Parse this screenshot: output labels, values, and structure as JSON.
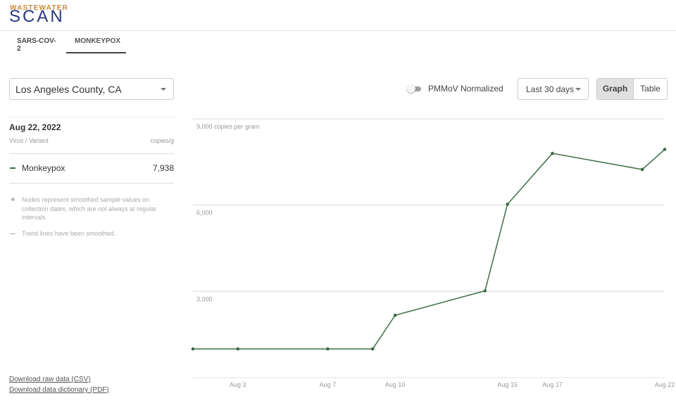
{
  "header": {
    "logo_top": "WASTEWATER",
    "logo_main": "SCAN"
  },
  "tabs": [
    {
      "label": "SARS-COV-2",
      "active": false
    },
    {
      "label": "MONKEYPOX",
      "active": true
    }
  ],
  "location": {
    "selected": "Los Angeles County, CA"
  },
  "controls": {
    "toggle_label": "PMMoV Normalized",
    "toggle_on": false,
    "range_selected": "Last 30 days",
    "view_graph": "Graph",
    "view_table": "Table",
    "active_view": "Graph"
  },
  "panel": {
    "date": "Aug 22, 2022",
    "col_left": "Virus / Variant",
    "col_right": "copies/g",
    "rows": [
      {
        "label": "Monkeypox",
        "value": "7,938",
        "color": "#3e6b45"
      }
    ],
    "note_nodes": "Nodes represent smoothed sample values on collection dates, which are not always at regular intervals.",
    "note_trend": "Trend lines have been smoothed."
  },
  "links": {
    "csv": "Download raw data (CSV)",
    "pdf": "Download data dictionary (PDF)"
  },
  "chart_data": {
    "type": "line",
    "title": "",
    "ylabel": "copies per gram",
    "xlabel": "",
    "ylim": [
      0,
      9000
    ],
    "y_ticks": [
      {
        "value": 0,
        "label": ""
      },
      {
        "value": 3000,
        "label": "3,000"
      },
      {
        "value": 6000,
        "label": "6,000"
      },
      {
        "value": 9000,
        "label": "9,000 copies per gram"
      }
    ],
    "x_range_days": [
      1,
      22
    ],
    "x_ticks": [
      {
        "day": 3,
        "label": "Aug 3"
      },
      {
        "day": 7,
        "label": "Aug 7"
      },
      {
        "day": 10,
        "label": "Aug 10"
      },
      {
        "day": 15,
        "label": "Aug 15"
      },
      {
        "day": 17,
        "label": "Aug 17"
      },
      {
        "day": 22,
        "label": "Aug 22"
      }
    ],
    "grid": true,
    "series": [
      {
        "name": "Monkeypox",
        "color": "#3e6b45",
        "points": [
          {
            "date": "Aug 1",
            "day": 1,
            "value": 1000
          },
          {
            "date": "Aug 3",
            "day": 3,
            "value": 1000
          },
          {
            "date": "Aug 7",
            "day": 7,
            "value": 1000
          },
          {
            "date": "Aug 9",
            "day": 9,
            "value": 1000
          },
          {
            "date": "Aug 10",
            "day": 10,
            "value": 2170
          },
          {
            "date": "Aug 14",
            "day": 14,
            "value": 3020
          },
          {
            "date": "Aug 15",
            "day": 15,
            "value": 6030
          },
          {
            "date": "Aug 17",
            "day": 17,
            "value": 7800
          },
          {
            "date": "Aug 21",
            "day": 21,
            "value": 7240
          },
          {
            "date": "Aug 22",
            "day": 22,
            "value": 7938
          }
        ]
      }
    ]
  }
}
